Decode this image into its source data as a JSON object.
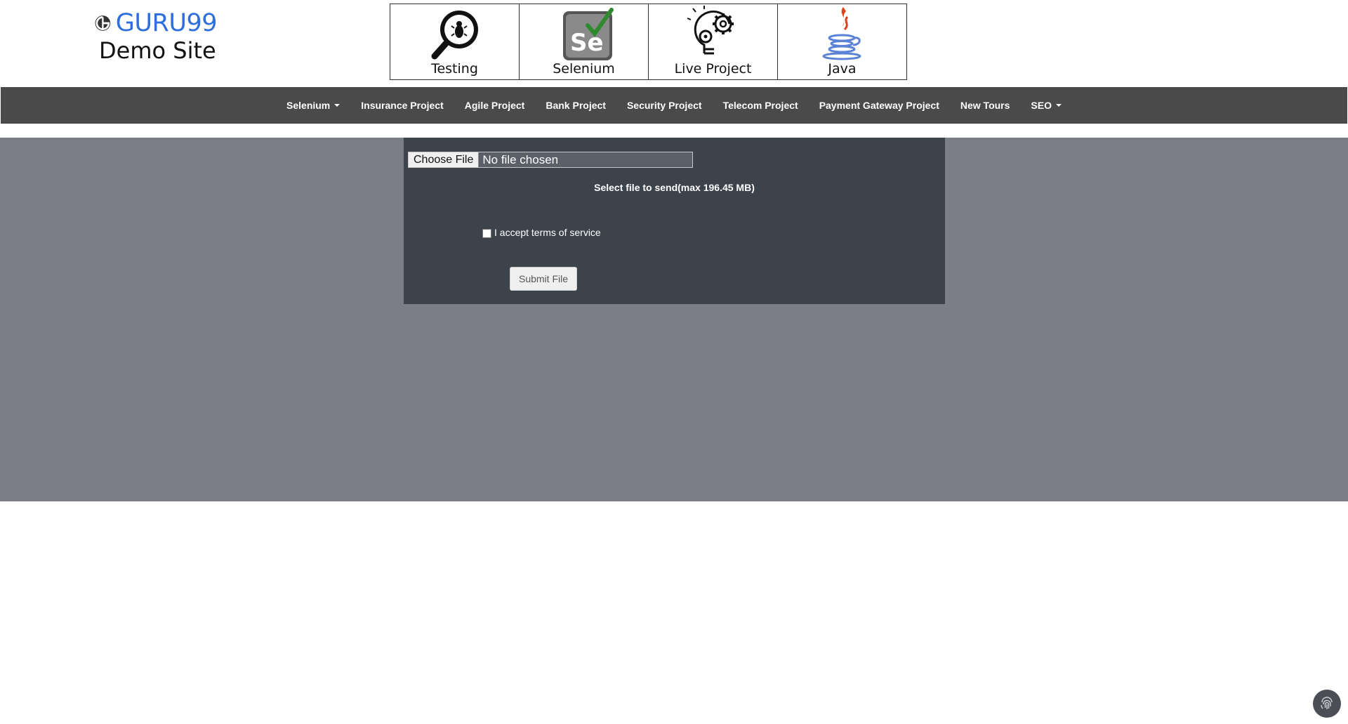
{
  "logo": {
    "brand": "GURU99",
    "subtitle": "Demo Site",
    "brand_color": "#2f6fdb"
  },
  "categories": [
    {
      "label": "Testing",
      "icon": "magnifier-bug-icon"
    },
    {
      "label": "Selenium",
      "icon": "selenium-logo-icon"
    },
    {
      "label": "Live Project",
      "icon": "lightbulb-gear-icon"
    },
    {
      "label": "Java",
      "icon": "java-cup-icon"
    }
  ],
  "nav": {
    "items": [
      {
        "label": "Selenium",
        "dropdown": true
      },
      {
        "label": "Insurance Project",
        "dropdown": false
      },
      {
        "label": "Agile Project",
        "dropdown": false
      },
      {
        "label": "Bank Project",
        "dropdown": false
      },
      {
        "label": "Security Project",
        "dropdown": false
      },
      {
        "label": "Telecom Project",
        "dropdown": false
      },
      {
        "label": "Payment Gateway Project",
        "dropdown": false
      },
      {
        "label": "New Tours",
        "dropdown": false
      },
      {
        "label": "SEO",
        "dropdown": true
      }
    ],
    "bg_color": "#4a4a4a"
  },
  "upload": {
    "choose_label": "Choose File",
    "file_status": "No file chosen",
    "select_text": "Select file to send(max 196.45 MB)",
    "terms_label": "I accept terms of service",
    "terms_checked": false,
    "submit_label": "Submit File"
  },
  "colors": {
    "page_bg": "#7b7d87",
    "panel_bg": "#3d434b"
  },
  "fab_icon": "fingerprint-icon"
}
